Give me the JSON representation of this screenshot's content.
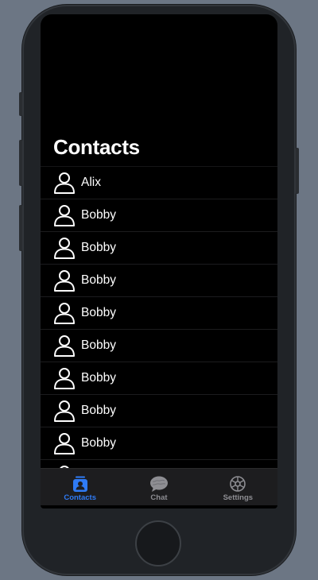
{
  "screen": {
    "title": "Contacts"
  },
  "contacts": [
    {
      "name": "Alix",
      "icon": "person-icon"
    },
    {
      "name": "Bobby",
      "icon": "person-icon"
    },
    {
      "name": "Bobby",
      "icon": "person-icon"
    },
    {
      "name": "Bobby",
      "icon": "person-icon"
    },
    {
      "name": "Bobby",
      "icon": "person-icon"
    },
    {
      "name": "Bobby",
      "icon": "person-icon"
    },
    {
      "name": "Bobby",
      "icon": "person-icon"
    },
    {
      "name": "Bobby",
      "icon": "person-icon"
    },
    {
      "name": "Bobby",
      "icon": "person-icon"
    },
    {
      "name": "",
      "icon": "person-icon"
    }
  ],
  "tabbar": {
    "tabs": [
      {
        "label": "Contacts",
        "icon": "contacts-icon",
        "active": true
      },
      {
        "label": "Chat",
        "icon": "chat-bubble-icon",
        "active": false
      },
      {
        "label": "Settings",
        "icon": "gear-icon",
        "active": false
      }
    ]
  },
  "colors": {
    "accent": "#2f7bf5",
    "inactive": "#8e8e93",
    "background": "#000000",
    "tabbar": "#1d1d1f"
  }
}
